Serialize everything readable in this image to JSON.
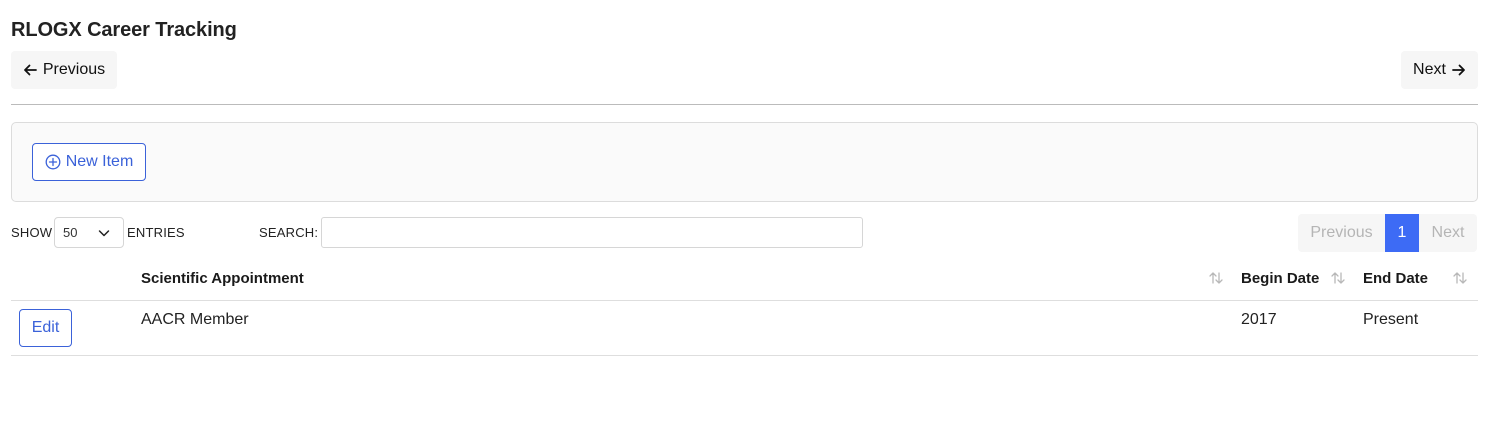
{
  "page": {
    "title": "RLOGX Career Tracking"
  },
  "top_nav": {
    "previous_label": "Previous",
    "next_label": "Next"
  },
  "toolbar": {
    "new_item_label": "New Item"
  },
  "table_controls": {
    "show_label": "SHOW",
    "entries_value": "50",
    "entries_label": "ENTRIES",
    "search_label": "SEARCH:",
    "search_value": "",
    "pagination": {
      "previous_label": "Previous",
      "current_page": "1",
      "next_label": "Next"
    }
  },
  "table": {
    "columns": [
      "Scientific Appointment",
      "Begin Date",
      "End Date"
    ],
    "rows": [
      {
        "action_label": "Edit",
        "scientific_appointment": "AACR Member",
        "begin_date": "2017",
        "end_date": "Present"
      }
    ]
  },
  "colors": {
    "accent": "#3d6bf5",
    "outline_button": "#3b62d9",
    "nav_button_bg": "#f6f6f6",
    "panel_bg": "#fafafa"
  },
  "icons": {
    "previous": "arrow-left-icon",
    "next": "arrow-right-icon",
    "new_item": "plus-circle-icon",
    "entries_select": "chevron-down-icon",
    "sort": "sort-arrows-icon"
  }
}
